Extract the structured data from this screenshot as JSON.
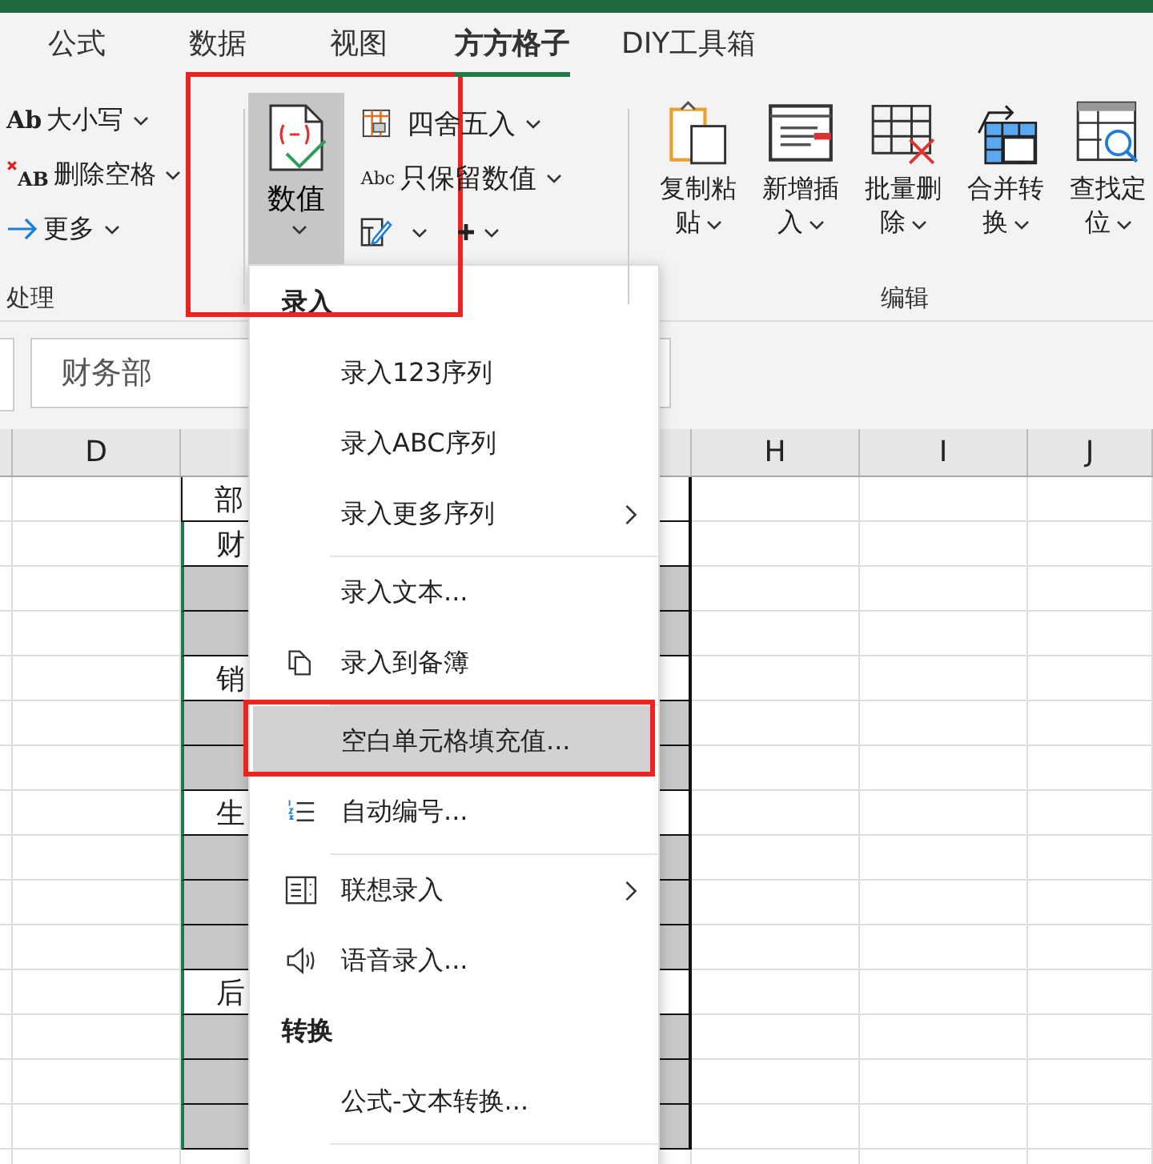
{
  "tabs": [
    {
      "label": "公式",
      "selected": false
    },
    {
      "label": "数据",
      "selected": false
    },
    {
      "label": "视图",
      "selected": false
    },
    {
      "label": "方方格子",
      "selected": true
    },
    {
      "label": "DIY工具箱",
      "selected": false
    }
  ],
  "text_group": {
    "items": [
      {
        "kind": "case",
        "icon_text": "Ab",
        "label": "大小写"
      },
      {
        "kind": "trim",
        "icon_text": "AB",
        "label": "删除空格"
      },
      {
        "kind": "more",
        "label": "更多"
      }
    ],
    "label": "处理"
  },
  "value_group": {
    "big_button": {
      "label": "数值",
      "pressed": true
    },
    "small_buttons": [
      {
        "kind": "round",
        "label": "四舍五入"
      },
      {
        "kind": "abc",
        "icon_text": "Abc",
        "label": "只保留数值"
      },
      {
        "kind": "edit"
      }
    ]
  },
  "edit_group": {
    "buttons": [
      {
        "label": "复制粘贴"
      },
      {
        "label": "新增插入"
      },
      {
        "label": "批量删除"
      },
      {
        "label": "合并转换"
      },
      {
        "label": "查找定位"
      }
    ],
    "label": "编辑"
  },
  "formula_bar": {
    "value": "财务部"
  },
  "column_headers": [
    {
      "label": "D"
    },
    {
      "label": "H"
    },
    {
      "label": "I"
    },
    {
      "label": "J"
    }
  ],
  "column_e": [
    {
      "text": "部",
      "blank": false
    },
    {
      "text": "财",
      "blank": false
    },
    {
      "blank": true
    },
    {
      "blank": true
    },
    {
      "text": "销",
      "blank": false
    },
    {
      "blank": true
    },
    {
      "blank": true
    },
    {
      "text": "生",
      "blank": false
    },
    {
      "blank": true
    },
    {
      "blank": true
    },
    {
      "blank": true
    },
    {
      "text": "后",
      "blank": false
    },
    {
      "blank": true
    },
    {
      "blank": true
    },
    {
      "blank": true
    }
  ],
  "menu": [
    {
      "kind": "header",
      "label": "录入"
    },
    {
      "kind": "item",
      "label": "录入123序列",
      "selected": false,
      "submenu": false
    },
    {
      "kind": "item",
      "label": "录入ABC序列",
      "selected": false,
      "submenu": false
    },
    {
      "kind": "item",
      "label": "录入更多序列",
      "selected": false,
      "submenu": true
    },
    {
      "kind": "separator"
    },
    {
      "kind": "item",
      "label": "录入文本...",
      "selected": false,
      "submenu": false
    },
    {
      "kind": "item",
      "label": "录入到备簿",
      "selected": false,
      "submenu": false,
      "icon": true
    },
    {
      "kind": "separator"
    },
    {
      "kind": "item",
      "label": "空白单元格填充值...",
      "selected": true,
      "submenu": false
    },
    {
      "kind": "item",
      "label": "自动编号...",
      "selected": false,
      "submenu": false,
      "icon": true
    },
    {
      "kind": "separator"
    },
    {
      "kind": "item",
      "label": "联想录入",
      "selected": false,
      "submenu": true,
      "icon": true
    },
    {
      "kind": "item",
      "label": "语音录入...",
      "selected": false,
      "submenu": false,
      "icon": true
    },
    {
      "kind": "header",
      "label": "转换"
    },
    {
      "kind": "item",
      "label": "公式-文本转换...",
      "selected": false,
      "submenu": false
    },
    {
      "kind": "separator"
    }
  ]
}
